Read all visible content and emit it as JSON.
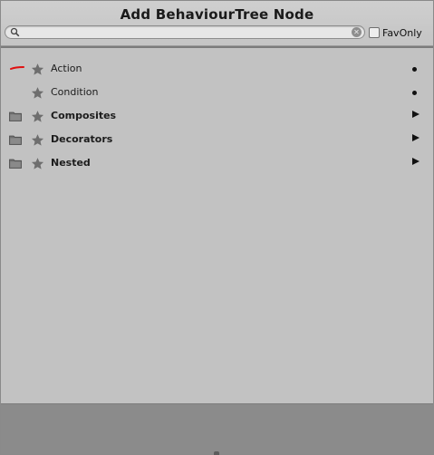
{
  "window": {
    "title": "Add BehaviourTree Node"
  },
  "search": {
    "value": "",
    "placeholder": "",
    "icon": "search-icon",
    "clear_icon": "close-icon"
  },
  "fav_only": {
    "label": "FavOnly",
    "checked": false
  },
  "items": [
    {
      "label": "Action",
      "type": "leaf",
      "bold": false,
      "indicator": "dot",
      "favorite_icon": "star-icon",
      "marker": "red-line"
    },
    {
      "label": "Condition",
      "type": "leaf",
      "bold": false,
      "indicator": "dot",
      "favorite_icon": "star-icon"
    },
    {
      "label": "Composites",
      "type": "folder",
      "bold": true,
      "indicator": "arrow",
      "favorite_icon": "star-icon",
      "folder_icon": "folder-icon"
    },
    {
      "label": "Decorators",
      "type": "folder",
      "bold": true,
      "indicator": "arrow",
      "favorite_icon": "star-icon",
      "folder_icon": "folder-icon"
    },
    {
      "label": "Nested",
      "type": "folder",
      "bold": true,
      "indicator": "arrow",
      "favorite_icon": "star-icon",
      "folder_icon": "folder-icon"
    }
  ],
  "colors": {
    "background": "#c2c2c2",
    "footer": "#8b8b8b",
    "star": "#6e6e6e",
    "marker": "#e01010"
  }
}
